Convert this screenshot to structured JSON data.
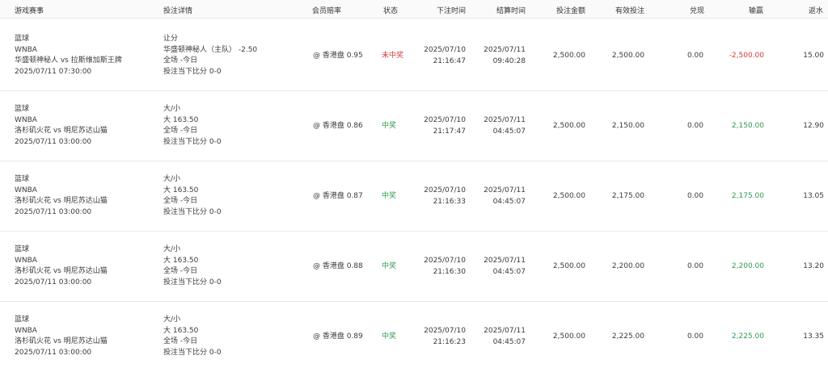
{
  "columns": {
    "game": "游戏赛事",
    "details": "投注详情",
    "odds": "会员赔率",
    "status": "状态",
    "bet_time": "下注时间",
    "settle_time": "结算时间",
    "bet_amount": "投注金额",
    "valid_bet": "有效投注",
    "cashout": "兑现",
    "win_loss": "输赢",
    "rebate": "返水"
  },
  "rows": [
    {
      "sport": "篮球",
      "league": "WNBA",
      "match": "华盛顿神秘人 vs 拉斯维加斯王牌",
      "match_time": "2025/07/11 07:30:00",
      "bet_type": "让分",
      "selection": "华盛顿神秘人（主队） -2.50",
      "period": "全场 -今日",
      "score": "投注当下比分 0-0",
      "odds": "@ 香港盘 0.95",
      "status": "未中奖",
      "status_kind": "lose",
      "bet_date": "2025/07/10",
      "bet_clock": "21:16:47",
      "settle_date": "2025/07/11",
      "settle_clock": "09:40:28",
      "bet_amount": "2,500.00",
      "valid_bet": "2,500.00",
      "cashout": "0.00",
      "win_loss": "-2,500.00",
      "rebate": "15.00"
    },
    {
      "sport": "篮球",
      "league": "WNBA",
      "match": "洛杉矶火花 vs 明尼苏达山猫",
      "match_time": "2025/07/11 03:00:00",
      "bet_type": "大/小",
      "selection": "大 163.50",
      "period": "全场 -今日",
      "score": "投注当下比分 0-0",
      "odds": "@ 香港盘 0.86",
      "status": "中奖",
      "status_kind": "win",
      "bet_date": "2025/07/10",
      "bet_clock": "21:17:47",
      "settle_date": "2025/07/11",
      "settle_clock": "04:45:07",
      "bet_amount": "2,500.00",
      "valid_bet": "2,150.00",
      "cashout": "0.00",
      "win_loss": "2,150.00",
      "rebate": "12.90"
    },
    {
      "sport": "篮球",
      "league": "WNBA",
      "match": "洛杉矶火花 vs 明尼苏达山猫",
      "match_time": "2025/07/11 03:00:00",
      "bet_type": "大/小",
      "selection": "大 163.50",
      "period": "全场 -今日",
      "score": "投注当下比分 0-0",
      "odds": "@ 香港盘 0.87",
      "status": "中奖",
      "status_kind": "win",
      "bet_date": "2025/07/10",
      "bet_clock": "21:16:33",
      "settle_date": "2025/07/11",
      "settle_clock": "04:45:07",
      "bet_amount": "2,500.00",
      "valid_bet": "2,175.00",
      "cashout": "0.00",
      "win_loss": "2,175.00",
      "rebate": "13.05"
    },
    {
      "sport": "篮球",
      "league": "WNBA",
      "match": "洛杉矶火花 vs 明尼苏达山猫",
      "match_time": "2025/07/11 03:00:00",
      "bet_type": "大/小",
      "selection": "大 163.50",
      "period": "全场 -今日",
      "score": "投注当下比分 0-0",
      "odds": "@ 香港盘 0.88",
      "status": "中奖",
      "status_kind": "win",
      "bet_date": "2025/07/10",
      "bet_clock": "21:16:30",
      "settle_date": "2025/07/11",
      "settle_clock": "04:45:07",
      "bet_amount": "2,500.00",
      "valid_bet": "2,200.00",
      "cashout": "0.00",
      "win_loss": "2,200.00",
      "rebate": "13.20"
    },
    {
      "sport": "篮球",
      "league": "WNBA",
      "match": "洛杉矶火花 vs 明尼苏达山猫",
      "match_time": "2025/07/11 03:00:00",
      "bet_type": "大/小",
      "selection": "大 163.50",
      "period": "全场 -今日",
      "score": "投注当下比分 0-0",
      "odds": "@ 香港盘 0.89",
      "status": "中奖",
      "status_kind": "win",
      "bet_date": "2025/07/10",
      "bet_clock": "21:16:23",
      "settle_date": "2025/07/11",
      "settle_clock": "04:45:07",
      "bet_amount": "2,500.00",
      "valid_bet": "2,225.00",
      "cashout": "0.00",
      "win_loss": "2,225.00",
      "rebate": "13.35"
    }
  ]
}
